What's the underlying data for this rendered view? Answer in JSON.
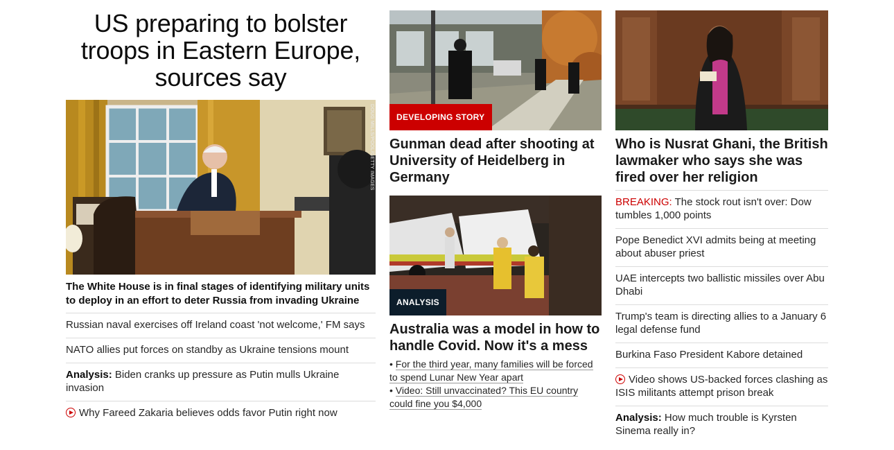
{
  "lead": {
    "title": "US preparing to bolster troops in Eastern Europe, sources say",
    "photo_credit": "DOUG MILLS/POOL/GETTY IMAGES",
    "subtitle": "The White House is in final stages of identifying military units to deploy in an effort to deter Russia from invading Ukraine",
    "links": [
      {
        "text": "Russian naval exercises off Ireland coast 'not welcome,' FM says"
      },
      {
        "text": "NATO allies put forces on standby as Ukraine tensions mount"
      },
      {
        "prefix": "Analysis:",
        "text": " Biden cranks up pressure as Putin mulls Ukraine invasion"
      },
      {
        "icon": "play-icon",
        "text": "Why Fareed Zakaria believes odds favor Putin right now"
      }
    ]
  },
  "middle": {
    "card1": {
      "tag": "DEVELOPING STORY",
      "title": "Gunman dead after shooting at University of Heidelberg in Germany"
    },
    "card2": {
      "tag": "ANALYSIS",
      "title": "Australia was a model in how to handle Covid. Now it's a mess",
      "bullets": [
        "For the third year, many families will be forced to spend Lunar New Year apart",
        "Video: Still unvaccinated? This EU country could fine you $4,000"
      ]
    }
  },
  "right": {
    "card": {
      "title": "Who is Nusrat Ghani, the British lawmaker who says she was fired over her religion"
    },
    "links": [
      {
        "breaking": "BREAKING:",
        "text": " The stock rout isn't over: Dow tumbles 1,000 points"
      },
      {
        "text": "Pope Benedict XVI admits being at meeting about abuser priest"
      },
      {
        "text": "UAE intercepts two ballistic missiles over Abu Dhabi"
      },
      {
        "text": "Trump's team is directing allies to a January 6 legal defense fund"
      },
      {
        "text": "Burkina Faso President Kabore detained"
      },
      {
        "icon": "play-icon",
        "text": "Video shows US-backed forces clashing as ISIS militants attempt prison break"
      },
      {
        "prefix": "Analysis:",
        "text": " How much trouble is Kyrsten Sinema really in?"
      }
    ]
  },
  "colors": {
    "breaking_red": "#cc0000",
    "analysis_tag": "#0c1d2b",
    "divider": "#dcdcdc"
  }
}
